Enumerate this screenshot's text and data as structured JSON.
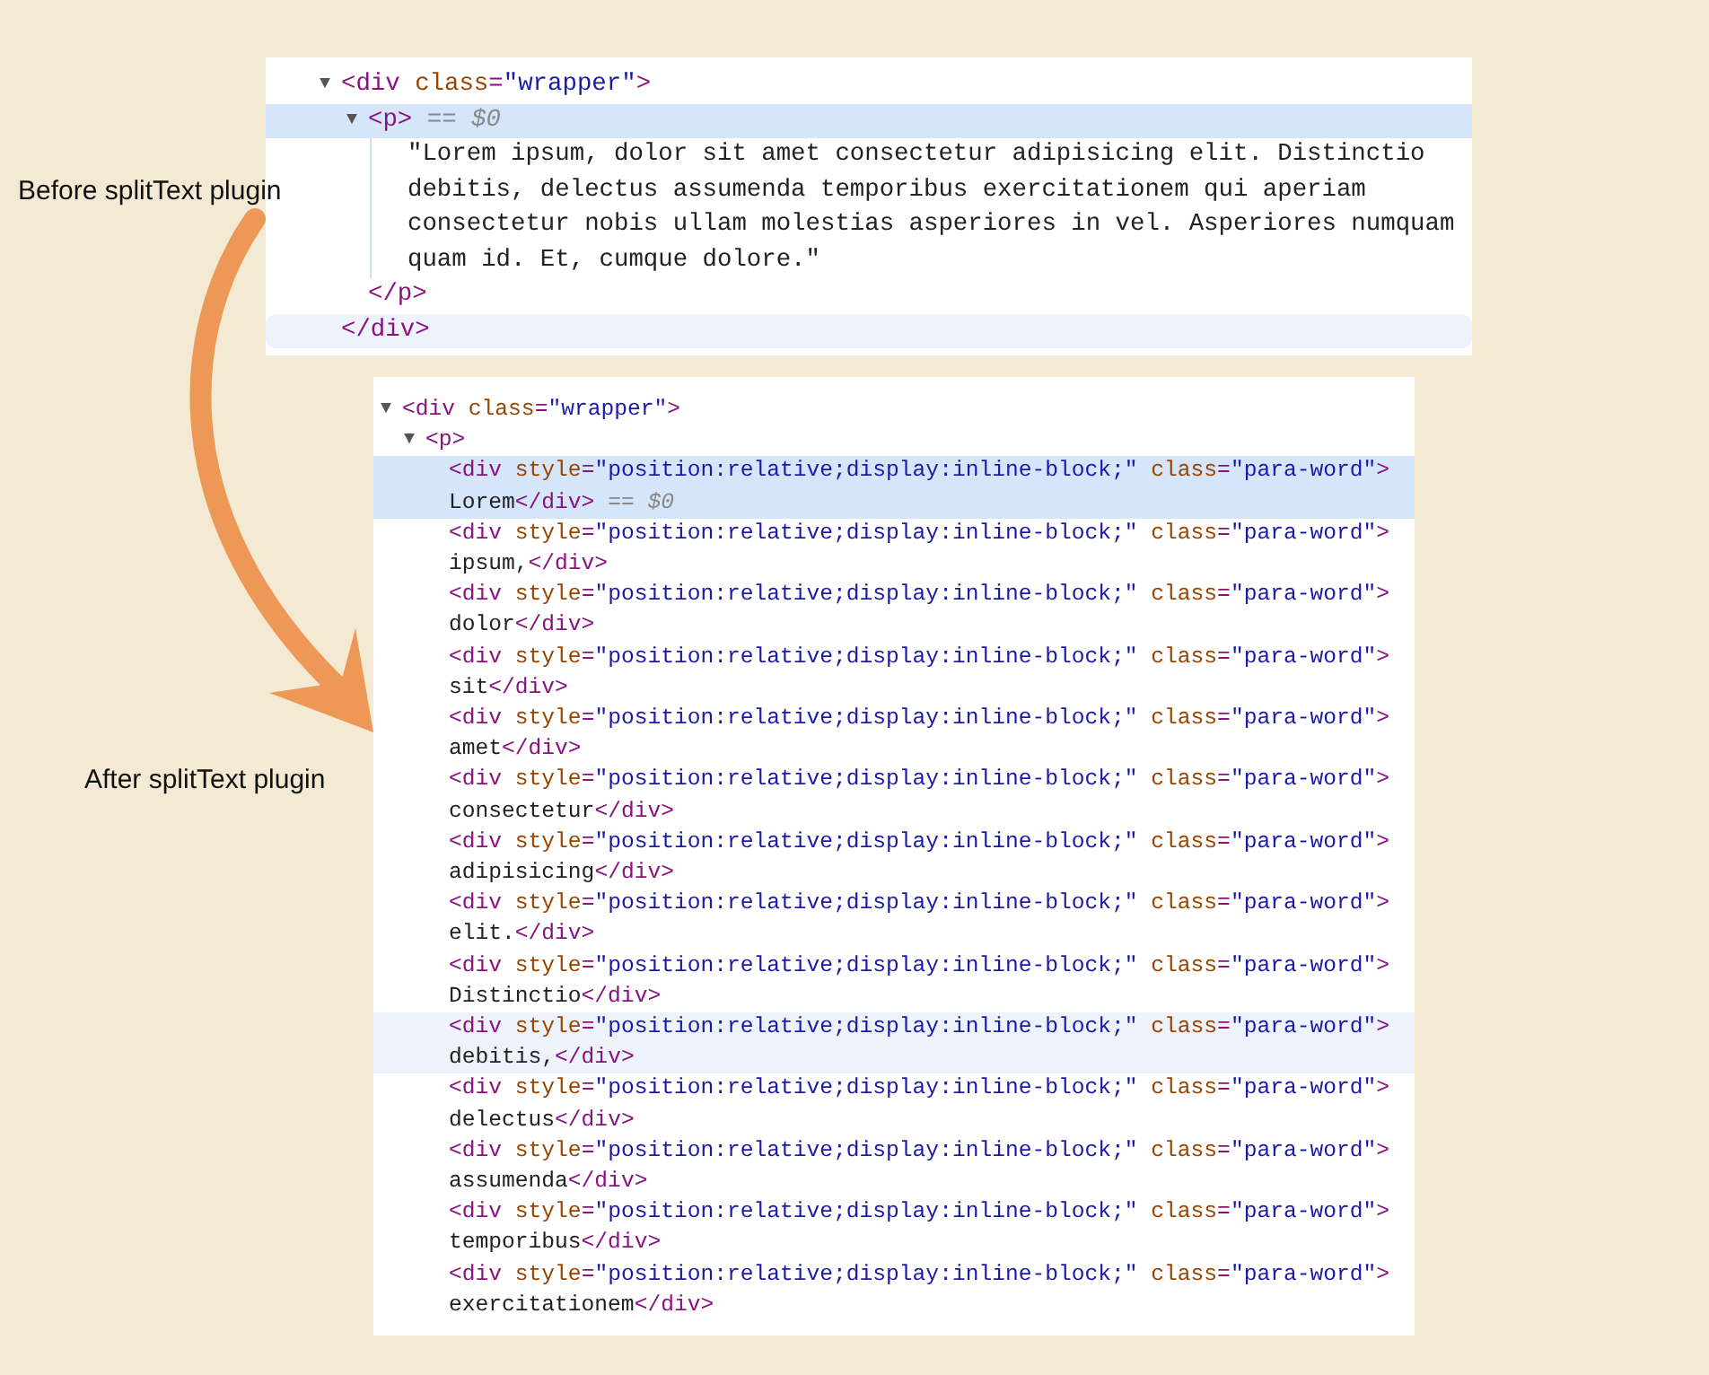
{
  "labels": [
    {
      "text": "Before splitText plugin"
    },
    {
      "text": "After splitText plugin"
    }
  ],
  "panels": [
    {
      "kind": "before",
      "tree": [
        {
          "kind": "element",
          "toggle": "▼",
          "selected": false,
          "open": [
            {
              "kind": "tag",
              "text": "<div"
            },
            {
              "kind": "attr",
              "text": " class"
            },
            {
              "kind": "tag",
              "text": "="
            },
            {
              "kind": "value",
              "text": "\"wrapper\""
            },
            {
              "kind": "tag",
              "text": ">"
            }
          ],
          "close": [
            {
              "kind": "tag",
              "text": "</div>"
            }
          ],
          "close_hovered": true,
          "children": [
            {
              "kind": "element",
              "toggle": "▼",
              "selected": true,
              "open": [
                {
                  "kind": "tag",
                  "text": "<p>"
                },
                {
                  "kind": "marker",
                  "text": " == $0"
                }
              ],
              "close": [
                {
                  "kind": "tag",
                  "text": "</p>"
                }
              ],
              "close_hovered": false,
              "children": [
                {
                  "kind": "text",
                  "text": "\"Lorem ipsum, dolor sit amet consectetur adipisicing elit. Distinctio debitis, delectus assumenda temporibus exercitationem qui aperiam consectetur nobis ullam molestias asperiores in vel. Asperiores numquam quam id. Et, cumque dolore.\""
                }
              ]
            }
          ]
        }
      ]
    },
    {
      "kind": "after",
      "tree": [
        {
          "kind": "element",
          "toggle": "▼",
          "selected": false,
          "open": [
            {
              "kind": "tag",
              "text": "<div"
            },
            {
              "kind": "attr",
              "text": " class"
            },
            {
              "kind": "tag",
              "text": "="
            },
            {
              "kind": "value",
              "text": "\"wrapper\""
            },
            {
              "kind": "tag",
              "text": ">"
            }
          ],
          "children": [
            {
              "kind": "element",
              "toggle": "▼",
              "selected": false,
              "open": [
                {
                  "kind": "tag",
                  "text": "<p>"
                }
              ],
              "children": [
                {
                  "kind": "leaf",
                  "selected": true,
                  "hovered": false,
                  "line1": [
                    {
                      "kind": "tag",
                      "text": "<div"
                    },
                    {
                      "kind": "attr",
                      "text": " style"
                    },
                    {
                      "kind": "tag",
                      "text": "="
                    },
                    {
                      "kind": "value",
                      "text": "\"position:relative;display:inline-block;\""
                    },
                    {
                      "kind": "attr",
                      "text": " class"
                    },
                    {
                      "kind": "tag",
                      "text": "="
                    },
                    {
                      "kind": "value",
                      "text": "\"para-word\""
                    },
                    {
                      "kind": "tag",
                      "text": ">"
                    }
                  ],
                  "line2": [
                    {
                      "kind": "plain",
                      "text": "Lorem"
                    },
                    {
                      "kind": "tag",
                      "text": "</div>"
                    },
                    {
                      "kind": "marker",
                      "text": " == $0"
                    }
                  ]
                },
                {
                  "kind": "leaf",
                  "selected": false,
                  "hovered": false,
                  "line1": [
                    {
                      "kind": "tag",
                      "text": "<div"
                    },
                    {
                      "kind": "attr",
                      "text": " style"
                    },
                    {
                      "kind": "tag",
                      "text": "="
                    },
                    {
                      "kind": "value",
                      "text": "\"position:relative;display:inline-block;\""
                    },
                    {
                      "kind": "attr",
                      "text": " class"
                    },
                    {
                      "kind": "tag",
                      "text": "="
                    },
                    {
                      "kind": "value",
                      "text": "\"para-word\""
                    },
                    {
                      "kind": "tag",
                      "text": ">"
                    }
                  ],
                  "line2": [
                    {
                      "kind": "plain",
                      "text": "ipsum,"
                    },
                    {
                      "kind": "tag",
                      "text": "</div>"
                    }
                  ]
                },
                {
                  "kind": "leaf",
                  "selected": false,
                  "hovered": false,
                  "line1": [
                    {
                      "kind": "tag",
                      "text": "<div"
                    },
                    {
                      "kind": "attr",
                      "text": " style"
                    },
                    {
                      "kind": "tag",
                      "text": "="
                    },
                    {
                      "kind": "value",
                      "text": "\"position:relative;display:inline-block;\""
                    },
                    {
                      "kind": "attr",
                      "text": " class"
                    },
                    {
                      "kind": "tag",
                      "text": "="
                    },
                    {
                      "kind": "value",
                      "text": "\"para-word\""
                    },
                    {
                      "kind": "tag",
                      "text": ">"
                    }
                  ],
                  "line2": [
                    {
                      "kind": "plain",
                      "text": "dolor"
                    },
                    {
                      "kind": "tag",
                      "text": "</div>"
                    }
                  ]
                },
                {
                  "kind": "leaf",
                  "selected": false,
                  "hovered": false,
                  "line1": [
                    {
                      "kind": "tag",
                      "text": "<div"
                    },
                    {
                      "kind": "attr",
                      "text": " style"
                    },
                    {
                      "kind": "tag",
                      "text": "="
                    },
                    {
                      "kind": "value",
                      "text": "\"position:relative;display:inline-block;\""
                    },
                    {
                      "kind": "attr",
                      "text": " class"
                    },
                    {
                      "kind": "tag",
                      "text": "="
                    },
                    {
                      "kind": "value",
                      "text": "\"para-word\""
                    },
                    {
                      "kind": "tag",
                      "text": ">"
                    }
                  ],
                  "line2": [
                    {
                      "kind": "plain",
                      "text": "sit"
                    },
                    {
                      "kind": "tag",
                      "text": "</div>"
                    }
                  ]
                },
                {
                  "kind": "leaf",
                  "selected": false,
                  "hovered": false,
                  "line1": [
                    {
                      "kind": "tag",
                      "text": "<div"
                    },
                    {
                      "kind": "attr",
                      "text": " style"
                    },
                    {
                      "kind": "tag",
                      "text": "="
                    },
                    {
                      "kind": "value",
                      "text": "\"position:relative;display:inline-block;\""
                    },
                    {
                      "kind": "attr",
                      "text": " class"
                    },
                    {
                      "kind": "tag",
                      "text": "="
                    },
                    {
                      "kind": "value",
                      "text": "\"para-word\""
                    },
                    {
                      "kind": "tag",
                      "text": ">"
                    }
                  ],
                  "line2": [
                    {
                      "kind": "plain",
                      "text": "amet"
                    },
                    {
                      "kind": "tag",
                      "text": "</div>"
                    }
                  ]
                },
                {
                  "kind": "leaf",
                  "selected": false,
                  "hovered": false,
                  "line1": [
                    {
                      "kind": "tag",
                      "text": "<div"
                    },
                    {
                      "kind": "attr",
                      "text": " style"
                    },
                    {
                      "kind": "tag",
                      "text": "="
                    },
                    {
                      "kind": "value",
                      "text": "\"position:relative;display:inline-block;\""
                    },
                    {
                      "kind": "attr",
                      "text": " class"
                    },
                    {
                      "kind": "tag",
                      "text": "="
                    },
                    {
                      "kind": "value",
                      "text": "\"para-word\""
                    },
                    {
                      "kind": "tag",
                      "text": ">"
                    }
                  ],
                  "line2": [
                    {
                      "kind": "plain",
                      "text": "consectetur"
                    },
                    {
                      "kind": "tag",
                      "text": "</div>"
                    }
                  ]
                },
                {
                  "kind": "leaf",
                  "selected": false,
                  "hovered": false,
                  "line1": [
                    {
                      "kind": "tag",
                      "text": "<div"
                    },
                    {
                      "kind": "attr",
                      "text": " style"
                    },
                    {
                      "kind": "tag",
                      "text": "="
                    },
                    {
                      "kind": "value",
                      "text": "\"position:relative;display:inline-block;\""
                    },
                    {
                      "kind": "attr",
                      "text": " class"
                    },
                    {
                      "kind": "tag",
                      "text": "="
                    },
                    {
                      "kind": "value",
                      "text": "\"para-word\""
                    },
                    {
                      "kind": "tag",
                      "text": ">"
                    }
                  ],
                  "line2": [
                    {
                      "kind": "plain",
                      "text": "adipisicing"
                    },
                    {
                      "kind": "tag",
                      "text": "</div>"
                    }
                  ]
                },
                {
                  "kind": "leaf",
                  "selected": false,
                  "hovered": false,
                  "line1": [
                    {
                      "kind": "tag",
                      "text": "<div"
                    },
                    {
                      "kind": "attr",
                      "text": " style"
                    },
                    {
                      "kind": "tag",
                      "text": "="
                    },
                    {
                      "kind": "value",
                      "text": "\"position:relative;display:inline-block;\""
                    },
                    {
                      "kind": "attr",
                      "text": " class"
                    },
                    {
                      "kind": "tag",
                      "text": "="
                    },
                    {
                      "kind": "value",
                      "text": "\"para-word\""
                    },
                    {
                      "kind": "tag",
                      "text": ">"
                    }
                  ],
                  "line2": [
                    {
                      "kind": "plain",
                      "text": "elit."
                    },
                    {
                      "kind": "tag",
                      "text": "</div>"
                    }
                  ]
                },
                {
                  "kind": "leaf",
                  "selected": false,
                  "hovered": false,
                  "line1": [
                    {
                      "kind": "tag",
                      "text": "<div"
                    },
                    {
                      "kind": "attr",
                      "text": " style"
                    },
                    {
                      "kind": "tag",
                      "text": "="
                    },
                    {
                      "kind": "value",
                      "text": "\"position:relative;display:inline-block;\""
                    },
                    {
                      "kind": "attr",
                      "text": " class"
                    },
                    {
                      "kind": "tag",
                      "text": "="
                    },
                    {
                      "kind": "value",
                      "text": "\"para-word\""
                    },
                    {
                      "kind": "tag",
                      "text": ">"
                    }
                  ],
                  "line2": [
                    {
                      "kind": "plain",
                      "text": "Distinctio"
                    },
                    {
                      "kind": "tag",
                      "text": "</div>"
                    }
                  ]
                },
                {
                  "kind": "leaf",
                  "selected": false,
                  "hovered": true,
                  "line1": [
                    {
                      "kind": "tag",
                      "text": "<div"
                    },
                    {
                      "kind": "attr",
                      "text": " style"
                    },
                    {
                      "kind": "tag",
                      "text": "="
                    },
                    {
                      "kind": "value",
                      "text": "\"position:relative;display:inline-block;\""
                    },
                    {
                      "kind": "attr",
                      "text": " class"
                    },
                    {
                      "kind": "tag",
                      "text": "="
                    },
                    {
                      "kind": "value",
                      "text": "\"para-word\""
                    },
                    {
                      "kind": "tag",
                      "text": ">"
                    }
                  ],
                  "line2": [
                    {
                      "kind": "plain",
                      "text": "debitis,"
                    },
                    {
                      "kind": "tag",
                      "text": "</div>"
                    }
                  ]
                },
                {
                  "kind": "leaf",
                  "selected": false,
                  "hovered": false,
                  "line1": [
                    {
                      "kind": "tag",
                      "text": "<div"
                    },
                    {
                      "kind": "attr",
                      "text": " style"
                    },
                    {
                      "kind": "tag",
                      "text": "="
                    },
                    {
                      "kind": "value",
                      "text": "\"position:relative;display:inline-block;\""
                    },
                    {
                      "kind": "attr",
                      "text": " class"
                    },
                    {
                      "kind": "tag",
                      "text": "="
                    },
                    {
                      "kind": "value",
                      "text": "\"para-word\""
                    },
                    {
                      "kind": "tag",
                      "text": ">"
                    }
                  ],
                  "line2": [
                    {
                      "kind": "plain",
                      "text": "delectus"
                    },
                    {
                      "kind": "tag",
                      "text": "</div>"
                    }
                  ]
                },
                {
                  "kind": "leaf",
                  "selected": false,
                  "hovered": false,
                  "line1": [
                    {
                      "kind": "tag",
                      "text": "<div"
                    },
                    {
                      "kind": "attr",
                      "text": " style"
                    },
                    {
                      "kind": "tag",
                      "text": "="
                    },
                    {
                      "kind": "value",
                      "text": "\"position:relative;display:inline-block;\""
                    },
                    {
                      "kind": "attr",
                      "text": " class"
                    },
                    {
                      "kind": "tag",
                      "text": "="
                    },
                    {
                      "kind": "value",
                      "text": "\"para-word\""
                    },
                    {
                      "kind": "tag",
                      "text": ">"
                    }
                  ],
                  "line2": [
                    {
                      "kind": "plain",
                      "text": "assumenda"
                    },
                    {
                      "kind": "tag",
                      "text": "</div>"
                    }
                  ]
                },
                {
                  "kind": "leaf",
                  "selected": false,
                  "hovered": false,
                  "line1": [
                    {
                      "kind": "tag",
                      "text": "<div"
                    },
                    {
                      "kind": "attr",
                      "text": " style"
                    },
                    {
                      "kind": "tag",
                      "text": "="
                    },
                    {
                      "kind": "value",
                      "text": "\"position:relative;display:inline-block;\""
                    },
                    {
                      "kind": "attr",
                      "text": " class"
                    },
                    {
                      "kind": "tag",
                      "text": "="
                    },
                    {
                      "kind": "value",
                      "text": "\"para-word\""
                    },
                    {
                      "kind": "tag",
                      "text": ">"
                    }
                  ],
                  "line2": [
                    {
                      "kind": "plain",
                      "text": "temporibus"
                    },
                    {
                      "kind": "tag",
                      "text": "</div>"
                    }
                  ]
                },
                {
                  "kind": "leaf",
                  "selected": false,
                  "hovered": false,
                  "line1": [
                    {
                      "kind": "tag",
                      "text": "<div"
                    },
                    {
                      "kind": "attr",
                      "text": " style"
                    },
                    {
                      "kind": "tag",
                      "text": "="
                    },
                    {
                      "kind": "value",
                      "text": "\"position:relative;display:inline-block;\""
                    },
                    {
                      "kind": "attr",
                      "text": " class"
                    },
                    {
                      "kind": "tag",
                      "text": "="
                    },
                    {
                      "kind": "value",
                      "text": "\"para-word\""
                    },
                    {
                      "kind": "tag",
                      "text": ">"
                    }
                  ],
                  "line2": [
                    {
                      "kind": "plain",
                      "text": "exercitationem"
                    },
                    {
                      "kind": "tag",
                      "text": "</div>"
                    }
                  ]
                }
              ]
            }
          ]
        }
      ]
    }
  ]
}
